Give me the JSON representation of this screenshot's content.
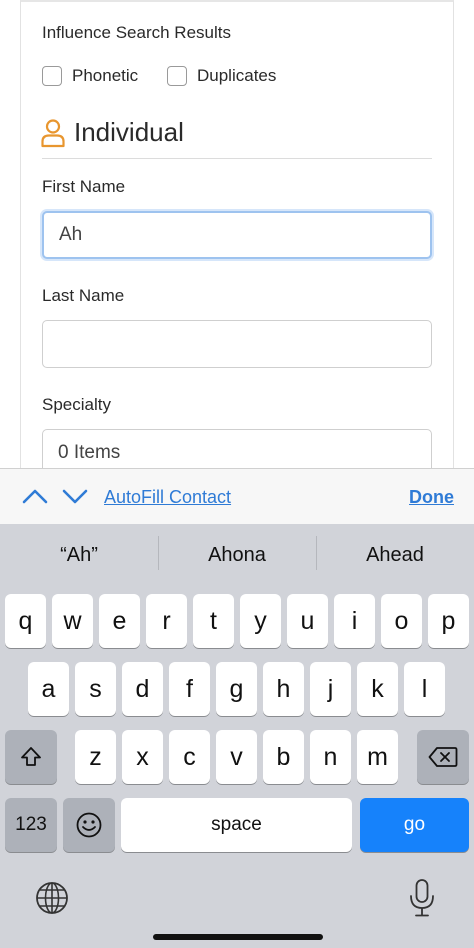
{
  "form": {
    "influence_label": "Influence Search Results",
    "checkboxes": [
      {
        "label": "Phonetic",
        "checked": false
      },
      {
        "label": "Duplicates",
        "checked": false
      }
    ],
    "section_title": "Individual",
    "section_icon": "person-icon",
    "fields": {
      "first_name_label": "First Name",
      "first_name_value": "Ah",
      "last_name_label": "Last Name",
      "last_name_value": "",
      "specialty_label": "Specialty",
      "specialty_value": "0 Items"
    },
    "accent_color": "#e8962f"
  },
  "accessory_bar": {
    "autofill_label": "AutoFill Contact",
    "done_label": "Done",
    "link_color": "#2f7bd6"
  },
  "keyboard": {
    "suggestions": [
      "“Ah”",
      "Ahona",
      "Ahead"
    ],
    "row1": [
      "q",
      "w",
      "e",
      "r",
      "t",
      "y",
      "u",
      "i",
      "o",
      "p"
    ],
    "row2": [
      "a",
      "s",
      "d",
      "f",
      "g",
      "h",
      "j",
      "k",
      "l"
    ],
    "row3": [
      "z",
      "x",
      "c",
      "v",
      "b",
      "n",
      "m"
    ],
    "numbers_key": "123",
    "space_key": "space",
    "go_key": "go",
    "go_color": "#1682fb"
  }
}
